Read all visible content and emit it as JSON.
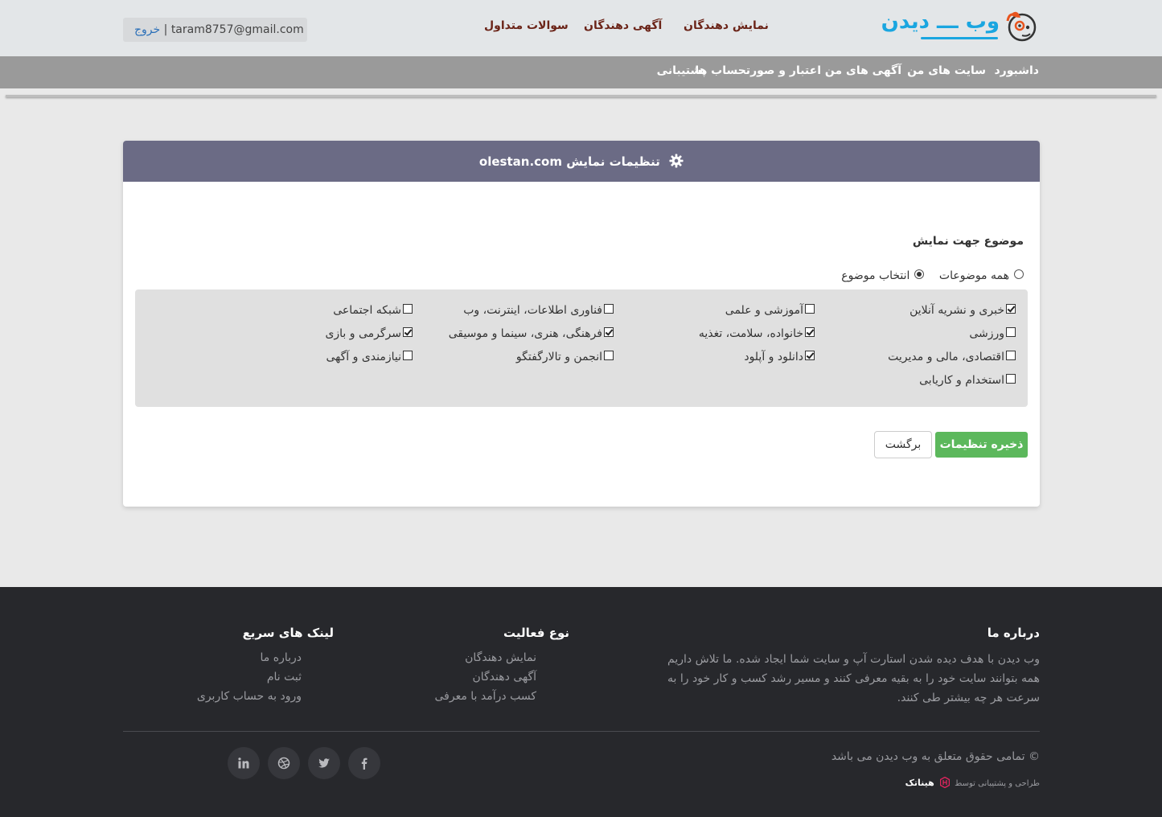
{
  "header": {
    "logo_text": "وب ـــ دیدن",
    "nav": [
      "نمایش دهندگان",
      "آگهی دهندگان",
      "سوالات متداول"
    ],
    "user_email": "taram8757@gmail.com",
    "separator": "|",
    "logout_label": "خروج"
  },
  "main_nav": [
    "داشبورد",
    "سایت های من",
    "آگهی های من",
    "اعتبار و صورتحساب ها",
    "پشتیبانی"
  ],
  "panel": {
    "title": "تنظیمات نمایش olestan.com",
    "section_label": "موضوع جهت نمایش",
    "radios": [
      {
        "label": "همه موضوعات",
        "selected": false
      },
      {
        "label": "انتخاب موضوع",
        "selected": true
      }
    ],
    "topics": [
      {
        "label": "خبری و نشریه آنلاین",
        "checked": true
      },
      {
        "label": "آموزشی و علمی",
        "checked": false
      },
      {
        "label": "فناوری اطلاعات، اینترنت، وب",
        "checked": false
      },
      {
        "label": "شبکه اجتماعی",
        "checked": false
      },
      {
        "label": "ورزشی",
        "checked": false
      },
      {
        "label": "خانواده، سلامت، تغذیه",
        "checked": true
      },
      {
        "label": "فرهنگی، هنری، سینما و موسیقی",
        "checked": true
      },
      {
        "label": "سرگرمی و بازی",
        "checked": true
      },
      {
        "label": "اقتصادی، مالی و مدیریت",
        "checked": false
      },
      {
        "label": "دانلود و آپلود",
        "checked": true
      },
      {
        "label": "انجمن و تالارگفتگو",
        "checked": false
      },
      {
        "label": "نیازمندی و آگهی",
        "checked": false
      },
      {
        "label": "استخدام و کاریابی",
        "checked": false
      }
    ],
    "save_label": "ذخیره تنظیمات",
    "back_label": "برگشت"
  },
  "footer": {
    "about_title": "درباره ما",
    "about_text": "وب دیدن با هدف دیده شدن استارت آپ و سایت شما ایجاد شده. ما تلاش داریم همه بتوانند سایت خود را به بقیه معرفی کنند و مسیر رشد کسب و کار خود را به سرعت هر چه بیشتر طی کنند.",
    "activity_title": "نوع فعالیت",
    "activity_links": [
      "نمایش دهندگان",
      "آگهی دهندگان",
      "کسب درآمد با معرفی"
    ],
    "quick_title": "لینک های سریع",
    "quick_links": [
      "درباره ما",
      "ثبت نام",
      "ورود به حساب کاربری"
    ],
    "copyright": "© تمامی حقوق متعلق به وب دیدن می باشد",
    "credit_prefix": "طراحی و پشتیبانی توسط",
    "credit_brand": "هیناتک",
    "social": [
      "facebook-icon",
      "twitter-icon",
      "dribbble-icon",
      "linkedin-icon"
    ]
  },
  "colors": {
    "accent_blue": "#1aa6e0",
    "nav_brown": "#6b2418",
    "panel_head": "#6b6b85",
    "save_green": "#5cb85c",
    "footer_bg": "#27282c"
  }
}
